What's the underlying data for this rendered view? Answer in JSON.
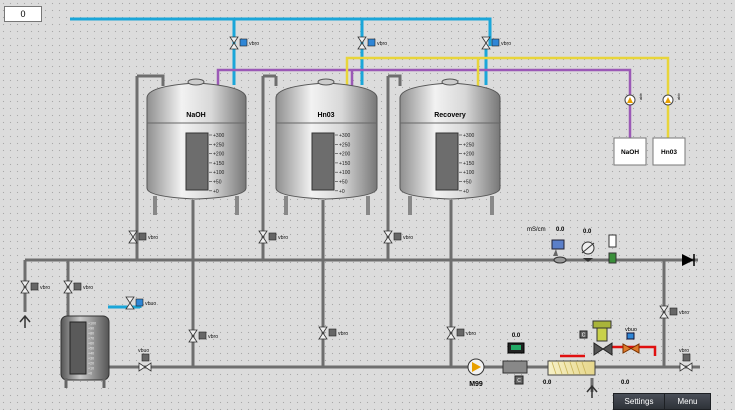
{
  "counter": {
    "value": "0"
  },
  "tanks": [
    {
      "name": "NaOH"
    },
    {
      "name": "Hn03"
    },
    {
      "name": "Recovery"
    }
  ],
  "tank_scale": [
    "+300",
    "+250",
    "+200",
    "+150",
    "+100",
    "+50",
    "+0"
  ],
  "small_tank_scale": [
    "+100",
    "+90",
    "+80",
    "+70",
    "+60",
    "+50",
    "+40",
    "+30",
    "+20",
    "+10",
    "+0"
  ],
  "valve_label": "vbro",
  "valve_label_alt": "vbuo",
  "supply_boxes": [
    {
      "label": "NaOH"
    },
    {
      "label": "Hn03"
    }
  ],
  "supply_pump_label": "abb",
  "conductivity": {
    "unit": "mS/cm",
    "value1": "0.0",
    "value2": "0.0"
  },
  "pump": {
    "label": "M99"
  },
  "readings": {
    "flowmeter": "0.0",
    "heater_left": "0.0",
    "heater_right": "0.0",
    "control_valve_value": "0.0"
  },
  "buttons": {
    "settings": "Settings",
    "menu": "Menu"
  },
  "colors": {
    "water": "#1aa6d9",
    "naoh_line": "#9b59b6",
    "hno3_line": "#e8d53a",
    "process": "#6e6e6e",
    "hot": "#e01010"
  }
}
